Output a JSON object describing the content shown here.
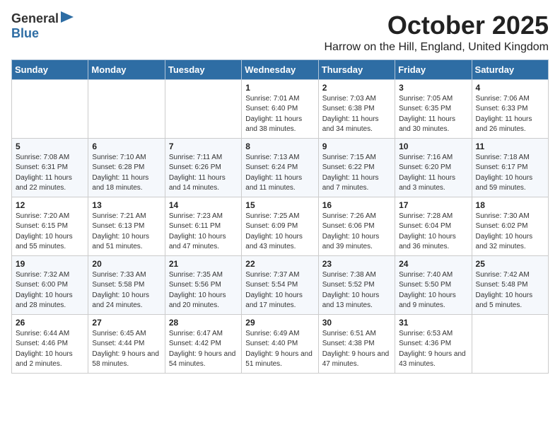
{
  "logo": {
    "general": "General",
    "blue": "Blue"
  },
  "title": "October 2025",
  "location": "Harrow on the Hill, England, United Kingdom",
  "weekdays": [
    "Sunday",
    "Monday",
    "Tuesday",
    "Wednesday",
    "Thursday",
    "Friday",
    "Saturday"
  ],
  "weeks": [
    [
      {
        "day": "",
        "info": ""
      },
      {
        "day": "",
        "info": ""
      },
      {
        "day": "",
        "info": ""
      },
      {
        "day": "1",
        "info": "Sunrise: 7:01 AM\nSunset: 6:40 PM\nDaylight: 11 hours\nand 38 minutes."
      },
      {
        "day": "2",
        "info": "Sunrise: 7:03 AM\nSunset: 6:38 PM\nDaylight: 11 hours\nand 34 minutes."
      },
      {
        "day": "3",
        "info": "Sunrise: 7:05 AM\nSunset: 6:35 PM\nDaylight: 11 hours\nand 30 minutes."
      },
      {
        "day": "4",
        "info": "Sunrise: 7:06 AM\nSunset: 6:33 PM\nDaylight: 11 hours\nand 26 minutes."
      }
    ],
    [
      {
        "day": "5",
        "info": "Sunrise: 7:08 AM\nSunset: 6:31 PM\nDaylight: 11 hours\nand 22 minutes."
      },
      {
        "day": "6",
        "info": "Sunrise: 7:10 AM\nSunset: 6:28 PM\nDaylight: 11 hours\nand 18 minutes."
      },
      {
        "day": "7",
        "info": "Sunrise: 7:11 AM\nSunset: 6:26 PM\nDaylight: 11 hours\nand 14 minutes."
      },
      {
        "day": "8",
        "info": "Sunrise: 7:13 AM\nSunset: 6:24 PM\nDaylight: 11 hours\nand 11 minutes."
      },
      {
        "day": "9",
        "info": "Sunrise: 7:15 AM\nSunset: 6:22 PM\nDaylight: 11 hours\nand 7 minutes."
      },
      {
        "day": "10",
        "info": "Sunrise: 7:16 AM\nSunset: 6:20 PM\nDaylight: 11 hours\nand 3 minutes."
      },
      {
        "day": "11",
        "info": "Sunrise: 7:18 AM\nSunset: 6:17 PM\nDaylight: 10 hours\nand 59 minutes."
      }
    ],
    [
      {
        "day": "12",
        "info": "Sunrise: 7:20 AM\nSunset: 6:15 PM\nDaylight: 10 hours\nand 55 minutes."
      },
      {
        "day": "13",
        "info": "Sunrise: 7:21 AM\nSunset: 6:13 PM\nDaylight: 10 hours\nand 51 minutes."
      },
      {
        "day": "14",
        "info": "Sunrise: 7:23 AM\nSunset: 6:11 PM\nDaylight: 10 hours\nand 47 minutes."
      },
      {
        "day": "15",
        "info": "Sunrise: 7:25 AM\nSunset: 6:09 PM\nDaylight: 10 hours\nand 43 minutes."
      },
      {
        "day": "16",
        "info": "Sunrise: 7:26 AM\nSunset: 6:06 PM\nDaylight: 10 hours\nand 39 minutes."
      },
      {
        "day": "17",
        "info": "Sunrise: 7:28 AM\nSunset: 6:04 PM\nDaylight: 10 hours\nand 36 minutes."
      },
      {
        "day": "18",
        "info": "Sunrise: 7:30 AM\nSunset: 6:02 PM\nDaylight: 10 hours\nand 32 minutes."
      }
    ],
    [
      {
        "day": "19",
        "info": "Sunrise: 7:32 AM\nSunset: 6:00 PM\nDaylight: 10 hours\nand 28 minutes."
      },
      {
        "day": "20",
        "info": "Sunrise: 7:33 AM\nSunset: 5:58 PM\nDaylight: 10 hours\nand 24 minutes."
      },
      {
        "day": "21",
        "info": "Sunrise: 7:35 AM\nSunset: 5:56 PM\nDaylight: 10 hours\nand 20 minutes."
      },
      {
        "day": "22",
        "info": "Sunrise: 7:37 AM\nSunset: 5:54 PM\nDaylight: 10 hours\nand 17 minutes."
      },
      {
        "day": "23",
        "info": "Sunrise: 7:38 AM\nSunset: 5:52 PM\nDaylight: 10 hours\nand 13 minutes."
      },
      {
        "day": "24",
        "info": "Sunrise: 7:40 AM\nSunset: 5:50 PM\nDaylight: 10 hours\nand 9 minutes."
      },
      {
        "day": "25",
        "info": "Sunrise: 7:42 AM\nSunset: 5:48 PM\nDaylight: 10 hours\nand 5 minutes."
      }
    ],
    [
      {
        "day": "26",
        "info": "Sunrise: 6:44 AM\nSunset: 4:46 PM\nDaylight: 10 hours\nand 2 minutes."
      },
      {
        "day": "27",
        "info": "Sunrise: 6:45 AM\nSunset: 4:44 PM\nDaylight: 9 hours\nand 58 minutes."
      },
      {
        "day": "28",
        "info": "Sunrise: 6:47 AM\nSunset: 4:42 PM\nDaylight: 9 hours\nand 54 minutes."
      },
      {
        "day": "29",
        "info": "Sunrise: 6:49 AM\nSunset: 4:40 PM\nDaylight: 9 hours\nand 51 minutes."
      },
      {
        "day": "30",
        "info": "Sunrise: 6:51 AM\nSunset: 4:38 PM\nDaylight: 9 hours\nand 47 minutes."
      },
      {
        "day": "31",
        "info": "Sunrise: 6:53 AM\nSunset: 4:36 PM\nDaylight: 9 hours\nand 43 minutes."
      },
      {
        "day": "",
        "info": ""
      }
    ]
  ]
}
